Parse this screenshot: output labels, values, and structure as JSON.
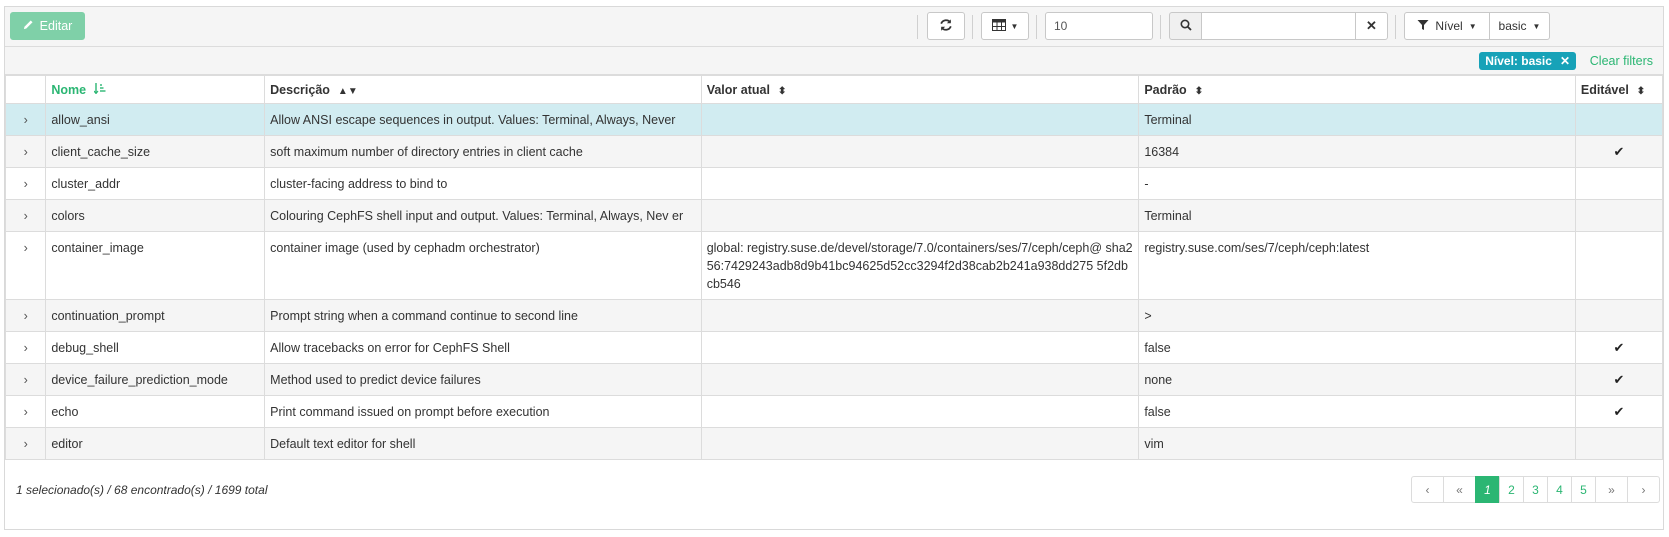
{
  "toolbar": {
    "edit_label": "Editar",
    "page_size_value": "10",
    "search_placeholder": "",
    "filter_label": "Nível",
    "filter_value": "basic"
  },
  "filters": {
    "badge_label": "Nível: basic",
    "clear_label": "Clear filters"
  },
  "table": {
    "headers": [
      "Nome",
      "Descrição",
      "Valor atual",
      "Padrão",
      "Editável"
    ],
    "rows": [
      {
        "name": "allow_ansi",
        "description": "Allow ANSI escape sequences in output. Values: Terminal, Always, Never",
        "current": "",
        "default": "Terminal",
        "editable": false
      },
      {
        "name": "client_cache_size",
        "description": "soft maximum number of directory entries in client cache",
        "current": "",
        "default": "16384",
        "editable": true
      },
      {
        "name": "cluster_addr",
        "description": "cluster-facing address to bind to",
        "current": "",
        "default": "-",
        "editable": false
      },
      {
        "name": "colors",
        "description": "Colouring CephFS shell input and output. Values: Terminal, Always, Nev er",
        "current": "",
        "default": "Terminal",
        "editable": false
      },
      {
        "name": "container_image",
        "description": "container image (used by cephadm orchestrator)",
        "current": "global: registry.suse.de/devel/storage/7.0/containers/ses/7/ceph/ceph@ sha256:7429243adb8d9b41bc94625d52cc3294f2d38cab2b241a938dd275 5f2dbcb546",
        "default": "registry.suse.com/ses/7/ceph/ceph:latest",
        "editable": false
      },
      {
        "name": "continuation_prompt",
        "description": "Prompt string when a command continue to second line",
        "current": "",
        "default": ">",
        "editable": false
      },
      {
        "name": "debug_shell",
        "description": "Allow tracebacks on error for CephFS Shell",
        "current": "",
        "default": "false",
        "editable": true
      },
      {
        "name": "device_failure_prediction_mode",
        "description": "Method used to predict device failures",
        "current": "",
        "default": "none",
        "editable": true
      },
      {
        "name": "echo",
        "description": "Print command issued on prompt before execution",
        "current": "",
        "default": "false",
        "editable": true
      },
      {
        "name": "editor",
        "description": "Default text editor for shell",
        "current": "",
        "default": "vim",
        "editable": false
      }
    ]
  },
  "footer": {
    "summary": "1 selecionado(s) / 68 encontrado(s) / 1699 total",
    "pages": [
      "1",
      "2",
      "3",
      "4",
      "5"
    ],
    "active_page": "1"
  },
  "colors": {
    "accent": "#2bb673",
    "selected_row": "#d1ecf1",
    "badge": "#17a2b8"
  }
}
